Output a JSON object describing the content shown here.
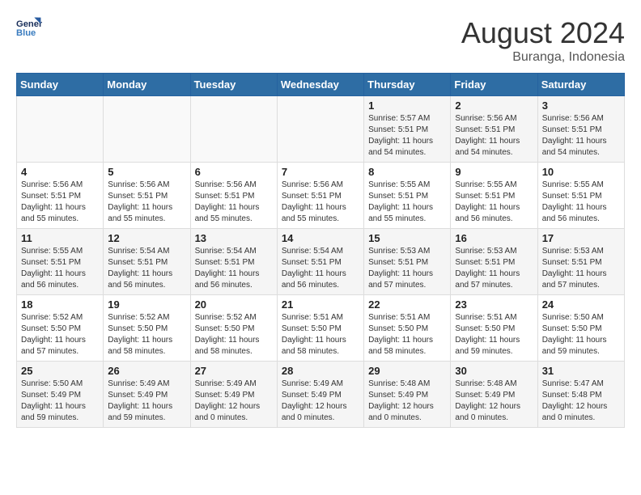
{
  "header": {
    "logo_line1": "General",
    "logo_line2": "Blue",
    "month_year": "August 2024",
    "location": "Buranga, Indonesia"
  },
  "days_of_week": [
    "Sunday",
    "Monday",
    "Tuesday",
    "Wednesday",
    "Thursday",
    "Friday",
    "Saturday"
  ],
  "weeks": [
    [
      {
        "day": "",
        "sunrise": "",
        "sunset": "",
        "daylight": ""
      },
      {
        "day": "",
        "sunrise": "",
        "sunset": "",
        "daylight": ""
      },
      {
        "day": "",
        "sunrise": "",
        "sunset": "",
        "daylight": ""
      },
      {
        "day": "",
        "sunrise": "",
        "sunset": "",
        "daylight": ""
      },
      {
        "day": "1",
        "sunrise": "Sunrise: 5:57 AM",
        "sunset": "Sunset: 5:51 PM",
        "daylight": "Daylight: 11 hours and 54 minutes."
      },
      {
        "day": "2",
        "sunrise": "Sunrise: 5:56 AM",
        "sunset": "Sunset: 5:51 PM",
        "daylight": "Daylight: 11 hours and 54 minutes."
      },
      {
        "day": "3",
        "sunrise": "Sunrise: 5:56 AM",
        "sunset": "Sunset: 5:51 PM",
        "daylight": "Daylight: 11 hours and 54 minutes."
      }
    ],
    [
      {
        "day": "4",
        "sunrise": "Sunrise: 5:56 AM",
        "sunset": "Sunset: 5:51 PM",
        "daylight": "Daylight: 11 hours and 55 minutes."
      },
      {
        "day": "5",
        "sunrise": "Sunrise: 5:56 AM",
        "sunset": "Sunset: 5:51 PM",
        "daylight": "Daylight: 11 hours and 55 minutes."
      },
      {
        "day": "6",
        "sunrise": "Sunrise: 5:56 AM",
        "sunset": "Sunset: 5:51 PM",
        "daylight": "Daylight: 11 hours and 55 minutes."
      },
      {
        "day": "7",
        "sunrise": "Sunrise: 5:56 AM",
        "sunset": "Sunset: 5:51 PM",
        "daylight": "Daylight: 11 hours and 55 minutes."
      },
      {
        "day": "8",
        "sunrise": "Sunrise: 5:55 AM",
        "sunset": "Sunset: 5:51 PM",
        "daylight": "Daylight: 11 hours and 55 minutes."
      },
      {
        "day": "9",
        "sunrise": "Sunrise: 5:55 AM",
        "sunset": "Sunset: 5:51 PM",
        "daylight": "Daylight: 11 hours and 56 minutes."
      },
      {
        "day": "10",
        "sunrise": "Sunrise: 5:55 AM",
        "sunset": "Sunset: 5:51 PM",
        "daylight": "Daylight: 11 hours and 56 minutes."
      }
    ],
    [
      {
        "day": "11",
        "sunrise": "Sunrise: 5:55 AM",
        "sunset": "Sunset: 5:51 PM",
        "daylight": "Daylight: 11 hours and 56 minutes."
      },
      {
        "day": "12",
        "sunrise": "Sunrise: 5:54 AM",
        "sunset": "Sunset: 5:51 PM",
        "daylight": "Daylight: 11 hours and 56 minutes."
      },
      {
        "day": "13",
        "sunrise": "Sunrise: 5:54 AM",
        "sunset": "Sunset: 5:51 PM",
        "daylight": "Daylight: 11 hours and 56 minutes."
      },
      {
        "day": "14",
        "sunrise": "Sunrise: 5:54 AM",
        "sunset": "Sunset: 5:51 PM",
        "daylight": "Daylight: 11 hours and 56 minutes."
      },
      {
        "day": "15",
        "sunrise": "Sunrise: 5:53 AM",
        "sunset": "Sunset: 5:51 PM",
        "daylight": "Daylight: 11 hours and 57 minutes."
      },
      {
        "day": "16",
        "sunrise": "Sunrise: 5:53 AM",
        "sunset": "Sunset: 5:51 PM",
        "daylight": "Daylight: 11 hours and 57 minutes."
      },
      {
        "day": "17",
        "sunrise": "Sunrise: 5:53 AM",
        "sunset": "Sunset: 5:51 PM",
        "daylight": "Daylight: 11 hours and 57 minutes."
      }
    ],
    [
      {
        "day": "18",
        "sunrise": "Sunrise: 5:52 AM",
        "sunset": "Sunset: 5:50 PM",
        "daylight": "Daylight: 11 hours and 57 minutes."
      },
      {
        "day": "19",
        "sunrise": "Sunrise: 5:52 AM",
        "sunset": "Sunset: 5:50 PM",
        "daylight": "Daylight: 11 hours and 58 minutes."
      },
      {
        "day": "20",
        "sunrise": "Sunrise: 5:52 AM",
        "sunset": "Sunset: 5:50 PM",
        "daylight": "Daylight: 11 hours and 58 minutes."
      },
      {
        "day": "21",
        "sunrise": "Sunrise: 5:51 AM",
        "sunset": "Sunset: 5:50 PM",
        "daylight": "Daylight: 11 hours and 58 minutes."
      },
      {
        "day": "22",
        "sunrise": "Sunrise: 5:51 AM",
        "sunset": "Sunset: 5:50 PM",
        "daylight": "Daylight: 11 hours and 58 minutes."
      },
      {
        "day": "23",
        "sunrise": "Sunrise: 5:51 AM",
        "sunset": "Sunset: 5:50 PM",
        "daylight": "Daylight: 11 hours and 59 minutes."
      },
      {
        "day": "24",
        "sunrise": "Sunrise: 5:50 AM",
        "sunset": "Sunset: 5:50 PM",
        "daylight": "Daylight: 11 hours and 59 minutes."
      }
    ],
    [
      {
        "day": "25",
        "sunrise": "Sunrise: 5:50 AM",
        "sunset": "Sunset: 5:49 PM",
        "daylight": "Daylight: 11 hours and 59 minutes."
      },
      {
        "day": "26",
        "sunrise": "Sunrise: 5:49 AM",
        "sunset": "Sunset: 5:49 PM",
        "daylight": "Daylight: 11 hours and 59 minutes."
      },
      {
        "day": "27",
        "sunrise": "Sunrise: 5:49 AM",
        "sunset": "Sunset: 5:49 PM",
        "daylight": "Daylight: 12 hours and 0 minutes."
      },
      {
        "day": "28",
        "sunrise": "Sunrise: 5:49 AM",
        "sunset": "Sunset: 5:49 PM",
        "daylight": "Daylight: 12 hours and 0 minutes."
      },
      {
        "day": "29",
        "sunrise": "Sunrise: 5:48 AM",
        "sunset": "Sunset: 5:49 PM",
        "daylight": "Daylight: 12 hours and 0 minutes."
      },
      {
        "day": "30",
        "sunrise": "Sunrise: 5:48 AM",
        "sunset": "Sunset: 5:49 PM",
        "daylight": "Daylight: 12 hours and 0 minutes."
      },
      {
        "day": "31",
        "sunrise": "Sunrise: 5:47 AM",
        "sunset": "Sunset: 5:48 PM",
        "daylight": "Daylight: 12 hours and 0 minutes."
      }
    ]
  ]
}
